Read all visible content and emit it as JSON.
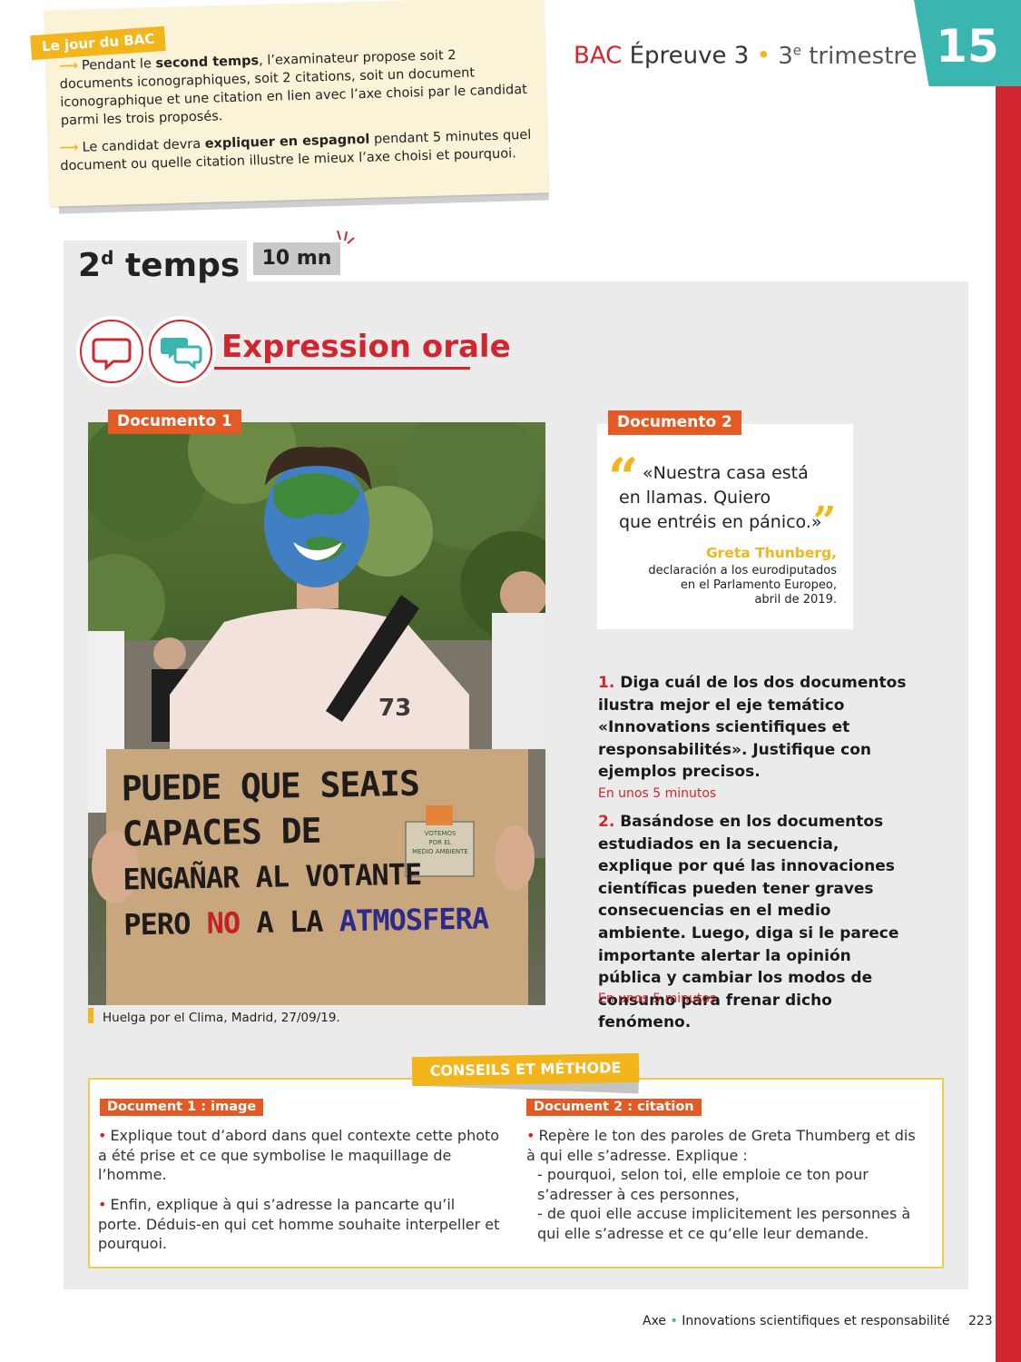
{
  "bac_note": {
    "badge": "Le jour du BAC",
    "para1_pre": "Pendant le ",
    "para1_bold": "second temps",
    "para1_post": ", l’examinateur propose soit 2 documents iconographiques, soit 2 citations, soit un document iconographique et une citation en lien avec l’axe choisi par le candidat parmi les trois proposés.",
    "para2_pre": "Le candidat devra ",
    "para2_bold": "expliquer en espagnol",
    "para2_post": " pendant 5 minutes quel document ou quelle citation illustre le mieux l’axe choisi et pourquoi.",
    "arrow_glyph": "⟶"
  },
  "header": {
    "bac": "BAC",
    "epreuve": "Épreuve 3",
    "separator": "•",
    "trimestre_num": "3",
    "trimestre_sup": "e",
    "trimestre_word": "trimestre",
    "chapter_number": "15"
  },
  "section": {
    "temps_num": "2",
    "temps_sup": "d",
    "temps_word": "temps",
    "timer": "10 mn",
    "title": "Expression orale",
    "icons": [
      "speech-bubble-icon",
      "dialogue-bubbles-icon"
    ]
  },
  "doc1": {
    "label": "Documento 1",
    "sign_lines": [
      "PUEDE QUE SEAIS",
      "CAPACES DE",
      "ENGAÑAR AL VOTANTE"
    ],
    "sign_last_a": "PERO",
    "sign_last_b": "NO",
    "sign_last_c": "A LA",
    "sign_last_d": "ATMOSFERA",
    "ballot_text": [
      "VOTEMOS",
      "POR EL",
      "MEDIO AMBIENTE"
    ],
    "shirt_number": "73",
    "caption": "Huelga por el Clima, Madrid, 27/09/19."
  },
  "doc2": {
    "label": "Documento 2",
    "quote_line1": "«Nuestra casa está",
    "quote_line2": "en llamas. Quiero",
    "quote_line3": "que entréis en pánico.»",
    "author": "Greta Thunberg,",
    "source_line1": "declaración a los eurodiputados",
    "source_line2": "en el Parlamento Europeo,",
    "source_line3": "abril de 2019."
  },
  "questions": [
    {
      "num": "1.",
      "text": "Diga cuál de los dos documentos ilustra mejor el eje temático «Innovations scientifiques et responsabilités». Justifique con ejemplos precisos.",
      "timing": "En unos 5 minutos"
    },
    {
      "num": "2.",
      "text": "Basándose en los documentos estudiados en la secuencia, explique por qué las innovaciones científicas pueden tener graves consecuencias en el medio ambiente. Luego, diga si le parece importante alertar la opinión pública y cambiar los modos de consumo para frenar dicho fenómeno.",
      "timing": "En unos 5 minutos"
    }
  ],
  "conseils": {
    "title": "CONSEILS ET MÉTHODE",
    "col1": {
      "label": "Document 1 : image",
      "bullets": [
        "Explique tout d’abord dans quel contexte cette photo a été prise et ce que symbolise le maquillage de l’homme.",
        "Enfin, explique à qui s’adresse la pancarte qu’il porte. Déduis-en qui cet homme souhaite interpeller et pourquoi."
      ]
    },
    "col2": {
      "label": "Document 2 : citation",
      "bullet_intro": "Repère le ton des paroles de Greta Thumberg et dis à qui elle s’adresse. Explique :",
      "sub1": "- pourquoi, selon toi, elle emploie ce ton pour s’adresser à ces personnes,",
      "sub2": "- de quoi elle accuse implicitement les personnes à qui elle s’adresse et ce qu’elle leur demande."
    }
  },
  "footer": {
    "axe": "Axe",
    "separator": "•",
    "text": "Innovations scientifiques et responsabilité",
    "page": "223"
  },
  "colors": {
    "accent_red": "#d1262f",
    "accent_yellow": "#f2b51c",
    "accent_orange": "#e35a24",
    "accent_teal": "#3ab5b0"
  }
}
